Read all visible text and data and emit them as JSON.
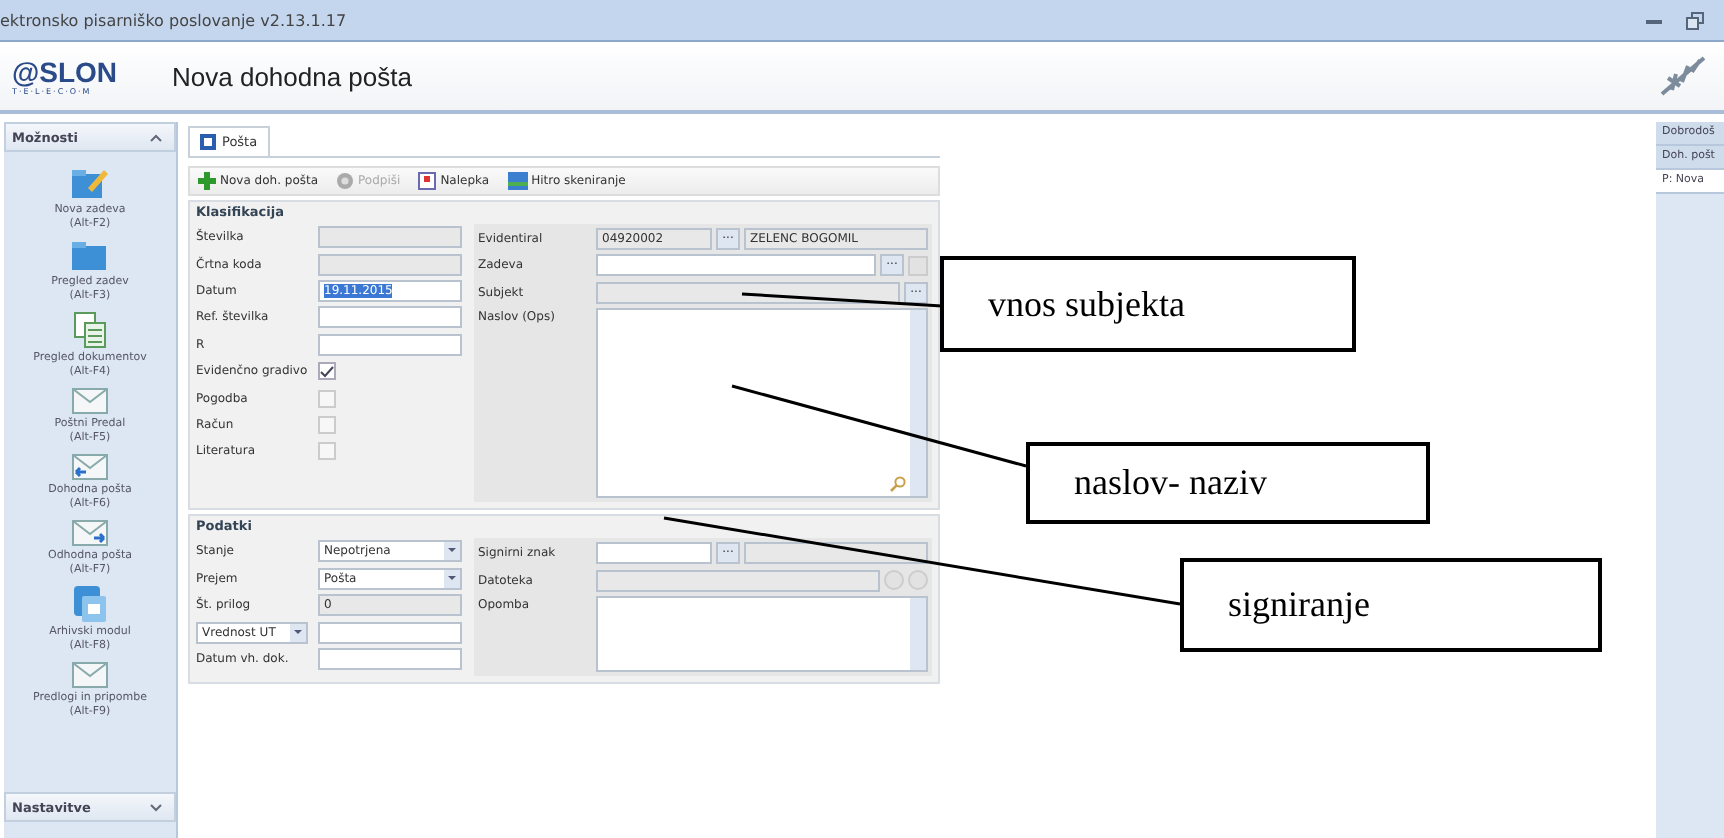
{
  "window": {
    "title": "ektronsko pisarniško poslovanje v2.13.1.17"
  },
  "header": {
    "logo": "@SLON",
    "logo_sub": "T·E·L·E·C·O·M",
    "title": "Nova dohodna pošta"
  },
  "sidebar": {
    "title": "Možnosti",
    "footer": "Nastavitve",
    "items": [
      {
        "label": "Nova zadeva",
        "shortcut": "(Alt-F2)",
        "kind": "edit"
      },
      {
        "label": "Pregled zadev",
        "shortcut": "(Alt-F3)",
        "kind": "folder"
      },
      {
        "label": "Pregled dokumentov",
        "shortcut": "(Alt-F4)",
        "kind": "documents"
      },
      {
        "label": "Poštni Predal",
        "shortcut": "(Alt-F5)",
        "kind": "envelope"
      },
      {
        "label": "Dohodna pošta",
        "shortcut": "(Alt-F6)",
        "kind": "incoming"
      },
      {
        "label": "Odhodna pošta",
        "shortcut": "(Alt-F7)",
        "kind": "outgoing"
      },
      {
        "label": "Arhivski modul",
        "shortcut": "(Alt-F8)",
        "kind": "archive"
      },
      {
        "label": "Predlogi in pripombe",
        "shortcut": "(Alt-F9)",
        "kind": "envelope"
      }
    ]
  },
  "tabs": [
    {
      "label": "Pošta",
      "selected": true
    }
  ],
  "toolbar": [
    {
      "label": "Nova doh. pošta",
      "kind": "add",
      "disabled": false
    },
    {
      "label": "Podpiši",
      "kind": "sign",
      "disabled": true
    },
    {
      "label": "Nalepka",
      "kind": "label",
      "disabled": false
    },
    {
      "label": "Hitro skeniranje",
      "kind": "scan",
      "disabled": false
    }
  ],
  "klasifikacija": {
    "title": "Klasifikacija",
    "left": [
      {
        "label": "Številka",
        "kind": "readonly"
      },
      {
        "label": "Črtna koda",
        "kind": "readonly"
      },
      {
        "label": "Datum",
        "kind": "input",
        "value": "19.11.2015",
        "selected": true
      },
      {
        "label": "Ref. številka",
        "kind": "input"
      },
      {
        "label": "R",
        "kind": "input"
      },
      {
        "label": "Evidenčno gradivo",
        "kind": "checkbox",
        "checked": true
      },
      {
        "label": "Pogodba",
        "kind": "checkbox",
        "checked": false
      },
      {
        "label": "Račun",
        "kind": "checkbox",
        "checked": false
      },
      {
        "label": "Literatura",
        "kind": "checkbox",
        "checked": false
      }
    ],
    "evidentiral": {
      "label": "Evidentiral",
      "code": "04920002",
      "button": "...",
      "name": "ZELENC BOGOMIL"
    },
    "zadeva": {
      "label": "Zadeva",
      "button": "..."
    },
    "subjekt": {
      "label": "Subjekt",
      "button": "..."
    },
    "naslov": {
      "label": "Naslov (Ops)"
    }
  },
  "podatki": {
    "title": "Podatki",
    "left": [
      {
        "label": "Stanje",
        "kind": "combo",
        "value": "Nepotrjena"
      },
      {
        "label": "Prejem",
        "kind": "combo",
        "value": "Pošta"
      },
      {
        "label": "Št. prilog",
        "kind": "readonly",
        "value": "0"
      },
      {
        "label": "Vrednost UT",
        "kind": "combo-label"
      },
      {
        "label": "Datum vh. dok.",
        "kind": "input"
      }
    ],
    "signirni": {
      "label": "Signirni znak",
      "button": "..."
    },
    "datoteka": {
      "label": "Datoteka"
    },
    "opomba": {
      "label": "Opomba"
    }
  },
  "right_tabs": [
    {
      "label": "Dobrodoš",
      "selected": false
    },
    {
      "label": "Doh. pošt",
      "selected": false
    },
    {
      "label": "P: Nova",
      "selected": true
    }
  ],
  "callouts": [
    {
      "text": "vnos subjekta"
    },
    {
      "text": "naslov- naziv"
    },
    {
      "text": "signiranje"
    }
  ]
}
